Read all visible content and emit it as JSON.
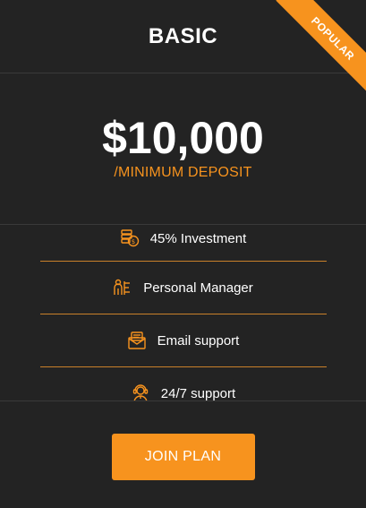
{
  "plan": {
    "name": "BASIC",
    "ribbon_label": "POPULAR",
    "price": "$10,000",
    "price_caption": "/MINIMUM DEPOSIT"
  },
  "features": [
    {
      "icon": "money-coin-icon",
      "label": "45% Investment"
    },
    {
      "icon": "manager-icon",
      "label": "Personal Manager"
    },
    {
      "icon": "email-icon",
      "label": "Email support"
    },
    {
      "icon": "support-agent-icon",
      "label": "24/7 support"
    }
  ],
  "cta": {
    "label": "JOIN PLAN"
  },
  "colors": {
    "accent": "#f7931e",
    "background": "#232323",
    "text": "#ffffff"
  }
}
